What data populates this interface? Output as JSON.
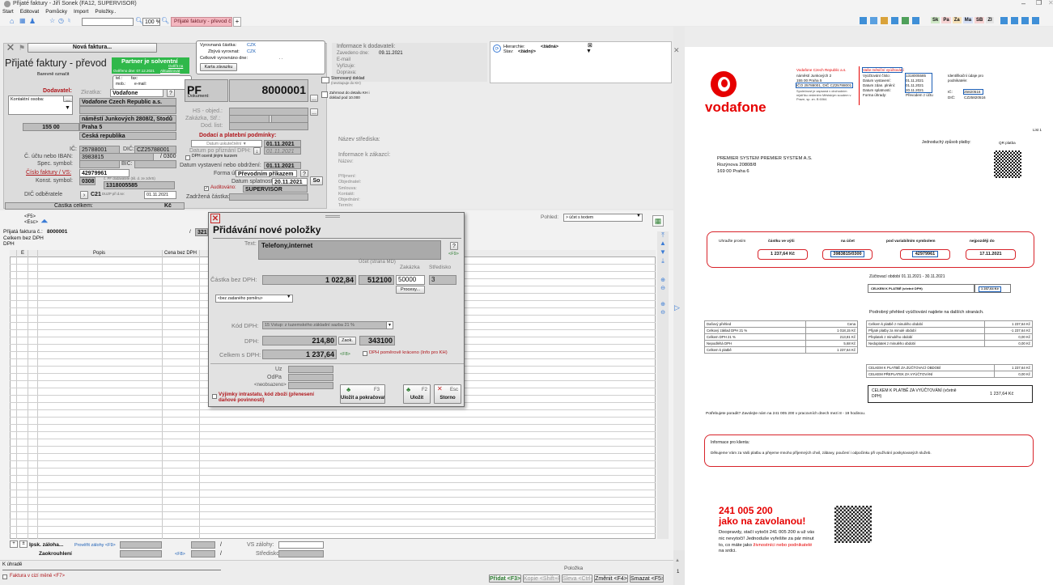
{
  "window": {
    "title": "Přijaté faktury - Jiří Sonek (FA12, SUPERVISOR)",
    "menu": [
      "Start",
      "Editovat",
      "Pomůcky",
      "Import",
      "Položky.."
    ],
    "zoom": "100 %",
    "tab_label": "Přijaté faktury - převod č. 2005",
    "tab_plus": "+",
    "toolbar_right": [
      "Sk",
      "Pa",
      "Za",
      "Ma",
      "SB",
      "ZI"
    ]
  },
  "header": {
    "new_invoice": "Nová faktura...",
    "title": "Přijaté faktury - převod",
    "partner_solvent": "Partner je solventní",
    "partner_detail": "Ověřit na",
    "partner_date": "Ověřeno dne: 07.12.2021",
    "partner_update": "Aktualizovat",
    "color_label": "Barevně označit",
    "tel": "tel.:",
    "fax": "fax:",
    "mob": "mob.:",
    "email": "e-mail:",
    "balance": {
      "paid_label": "Vyrovnaná částka:",
      "paid_cur": "CZK",
      "remaining_label": "Zbývá vyrovnat:",
      "remaining_cur": "CZK",
      "total_label": "Celkově vyrovnáno dne:",
      "total_val": ". .",
      "card_button": "Karta závazku"
    },
    "supplier_info": {
      "title": "Informace k dodavateli:",
      "date_label": "Zavedeno dne:",
      "date_val": "09.11.2021",
      "rows": [
        "E-mail",
        "Vyřizuje:",
        "Doprava:"
      ]
    },
    "hierarchy": {
      "label1": "Hierarchie:",
      "val1": "<žádná>",
      "label2": "Stav:",
      "val2": "<žádný>",
      "close": "⊠"
    }
  },
  "supplier": {
    "title": "Dodavatel:",
    "contact_label": "Kontaktní osoba:",
    "short_label": "Zkratka:",
    "short_val": "Vodafone",
    "name": "Vodafone Czech Republic a.s.",
    "street": "náměstí Junkových 2808/2, Stodů",
    "zip": "155 00",
    "city": "Praha 5",
    "country": "Česká republika",
    "ic_label": "IČ:",
    "ic_val": "25788001",
    "dic_label": "DIČ:",
    "dic_val": "CZ25788001",
    "iban_label": "Č. účtu nebo IBAN:",
    "iban_val": "3983815",
    "bank": "/ 0300",
    "spec_label": "Spec. symbol:",
    "bic_label": "BIC:",
    "vs_label": "Číslo faktury / VS:",
    "vs_val": "42979961",
    "ks_label": "Konst. symbol:",
    "ks_val": "0308",
    "evid_note": "č. PF dodavatele (tiš. d. ze zdVS)",
    "evid_val": "1318005585",
    "dic_odb_label": "DIČ odběratele",
    "dic_odb_val": "C21",
    "duzp_label": "DUZP při d.se:",
    "duzp_val": "01.11.2021",
    "total_label": "Částka celkem:",
    "total_cur": "Kč"
  },
  "document": {
    "code": "PF",
    "number": "8000001",
    "doc_label": "Dokument:",
    "hs_label": "HS - objed.:",
    "zak_label": "Zakázka, Stř.:",
    "dod_label": "Dod. list:",
    "storno_label": "Stornovaný doklad",
    "storno_note": "(nevstupuje do KH)",
    "kh_label": "Zahrnout do detailu KH i doklad pod 10.000",
    "terms_title": "Dodací a platební podmínky:",
    "uzp_label": "Datum uskutečnění",
    "uzp_val": "01.11.2021",
    "dph_label": "Datum po přiznání DPH:",
    "dph_val": "01.11.2021",
    "cur_label": "DPH ocenit jiným kurzem",
    "issue_label": "Datum vystavení nebo obdržení:",
    "issue_val": "01.11.2021",
    "pay_label": "Forma úhrady:",
    "pay_val": "Převodním příkazem",
    "due_label": "Datum splatnosti:",
    "due_val": "20.11.2021",
    "so": "So",
    "audit_label": "Auditováno:",
    "audit_val": "SUPERVISOR",
    "hold_label": "Zadržená částka:"
  },
  "center_info": {
    "stredisko": "Název střediska:",
    "customer": "Informace k zákazcí:",
    "name_lbl": "Název:",
    "rows": [
      "Příjmení:",
      "Objednatel:",
      "Smlouva:",
      "Kontakt:",
      "Objednání:",
      "Termín:"
    ]
  },
  "items": {
    "f5": "<F5>",
    "esc": "<Esc>",
    "invoice_label": "Přijatá faktura č.:",
    "invoice_val": "8000001",
    "slash": "/",
    "page": "321",
    "base_label": "Celkem bez DPH",
    "dph": "DPH",
    "col_e": "E",
    "col_desc": "Popis",
    "col_price": "Cena bez DPH",
    "view_label": "Pohled:",
    "view_val": "> účet s textem",
    "orig_label": "z původního dokladu (u dobropisů)",
    "zal_label": "Ipsk. záloha...",
    "zal_check": "Prověřit zálohy <F9>",
    "round_label": "Zaokrouhlení",
    "f8": "<F8>",
    "vs_zal": "VS zálohy:",
    "stred": "Středisko:",
    "k_uhrade": "K úhradě",
    "fx_label": "Faktura v cizí měně <F7>",
    "polozka": "Položka",
    "actions": [
      "Přidat <F3>",
      "Kopie <Shift+F3>",
      "Sleva <Ctrl+S>",
      "Změnit <F4>",
      "Smazat <F5>"
    ]
  },
  "dialog": {
    "title": "Přidávání nové položky",
    "text_label": "Text:",
    "text_val": "Telefony,internet",
    "f9": "<F9>",
    "help": "?",
    "acct_label": "Účet (strana MD)",
    "zak_label": "Zakázka",
    "stred_label": "Středisko",
    "base_label": "Částka bez DPH:",
    "base_val": "1 022,84",
    "acct_val": "512100",
    "zak_val": "50000",
    "stred_val": "3",
    "process_btn": "Procesy...",
    "note_val": "<bez zadaného poměru>",
    "vat_label": "Kód DPH:",
    "vat_val": "15 Vstup: z tuzemského základní sazba 21 %",
    "dph_label": "DPH:",
    "dph_val": "214,80",
    "zaok_btn": "Zaok.",
    "dph_acct": "343100",
    "total_label": "Celkem s DPH:",
    "total_val": "1 237,64",
    "f8": "<F8>",
    "ratio_label": "DPH poměrově kráceno (Info pro KH)",
    "uz_label": "Uz",
    "odpa_label": "OdPa",
    "unused_label": "<neobsazeno>",
    "exc_label": "Výjimky intrastatu, kód zboží (přenesení daňové povinnosti)",
    "save_cont": "Uložit a pokračovat",
    "save": "Uložit",
    "storno": "Storno",
    "f3": "F3",
    "f2": "F2",
    "escb": "Esc"
  },
  "invoice": {
    "brand": "vodafone",
    "company": "Vodafone Czech Republic a.s.",
    "addr1": "náměstí Junkových 2",
    "addr2": "155 00 Praha 5",
    "ids": "IČO 25788001, DIČ CZ25788001",
    "reg": "Společnost je zapsaná v obchodním rejstříku vedeném Městským soudem v Praze, sp. zn. B 6064.",
    "stmt_title": "Vaše měsíční vyúčtování",
    "labels": [
      "Vyúčtování číslo:",
      "Datum vystavení:",
      "Datum zdan. plnění:",
      "Datum splatnosti:",
      "Forma úhrady:"
    ],
    "values": [
      "1318005585",
      "01.11.2021",
      "01.11.2021",
      "20.11.2021",
      "Převodem z účtu"
    ],
    "ident_title": "Identifikační údaje pro podnikatele:",
    "ic": "IČ:",
    "ic_val": "25820516",
    "dic": "DIČ:",
    "dic_val": "CZ25820516",
    "page": "List 1",
    "pay_method": "Jednoduchý způsob platby:",
    "qr": "QR platba",
    "cust1": "PREMIER SYSTEM PREMIER SYSTEM A.S.",
    "cust2": "Rozýnova 20808/8",
    "cust3": "169 00  Praha 6",
    "pay": {
      "h0": "Uhraďte prosím",
      "h1": "částku ve výši",
      "h2": "na účet",
      "h3": "pod variabilním symbolem",
      "h4": "nejpozději do",
      "v1": "1 237,64 Kč",
      "v2": "3983815/0300",
      "v3": "42979961",
      "v4": "17.11.2021"
    },
    "period": "Zúčtovací období 01.11.2021 - 30.11.2021",
    "total_line": "CELKEM K PLATBĚ (včetně DPH)",
    "total_val": "1 237,64 Kč",
    "detail_title": "Podrobný přehled vyúčtování najdete na dalších stranách.",
    "tax": [
      [
        "Daňový přehled",
        "Cena"
      ],
      [
        "Celkový základ DPH 21 %",
        "1 018,15 Kč"
      ],
      [
        "Celkem DPH 21 %",
        "213,81 Kč"
      ],
      [
        "Nepodléhá DPH",
        "5,68 Kč"
      ],
      [
        "Celkem k platbě",
        "1 237,64 Kč"
      ]
    ],
    "summary": [
      [
        "Celkem k platbě z minulého období",
        "1 237,64 Kč"
      ],
      [
        "Přijaté platby za minulé období",
        "-1 237,64 Kč"
      ],
      [
        "Přeplatek z minulého období",
        "0,00 Kč"
      ],
      [
        "Nedoplatek z minulého období",
        "0,00 Kč"
      ]
    ],
    "summary2": [
      [
        "CELKEM K PLATBĚ ZA ZÚČTOVACÍ OBDOBÍ",
        "1 237,64 Kč"
      ],
      [
        "CELKEM PŘEPLATEK ZA VYÚČTOVÁNÍ",
        "0,00 Kč"
      ]
    ],
    "grand_label": "CELKEM K PLATBĚ ZA VYÚČTOVÁNÍ (včetně DPH)",
    "grand_val": "1 237,64 Kč",
    "help": "Potřebujete poradit? Zavolejte nám na 241 005 200 v pracovních dnech mezi 8 - 19 hodinou.",
    "info_title": "Informace pro klienta:",
    "info_text": "Děkujeme Vám za Vaši platbu a přejeme mnoho příjemných chvil, zábavy, poučení i odpočinku při využívání poskytovaných služeb.",
    "promo1": "241 005 200",
    "promo2": "jako na zavolanou!",
    "promo3": "Doopravdy, stačí vytočit 241 005 200 a už vás nic nevytočí! Jednoduše vyřešíte za pár minut to, co máte jako",
    "promo4": "živnostníci nebo podnikatelé",
    "promo5": "na srdci.",
    "pagenum": "1"
  },
  "colors": {
    "vodafone_red": "#e60000",
    "solvent_green": "#2fb84a",
    "tab_pink": "#f4b7c0",
    "dialog_title": "#111111"
  }
}
